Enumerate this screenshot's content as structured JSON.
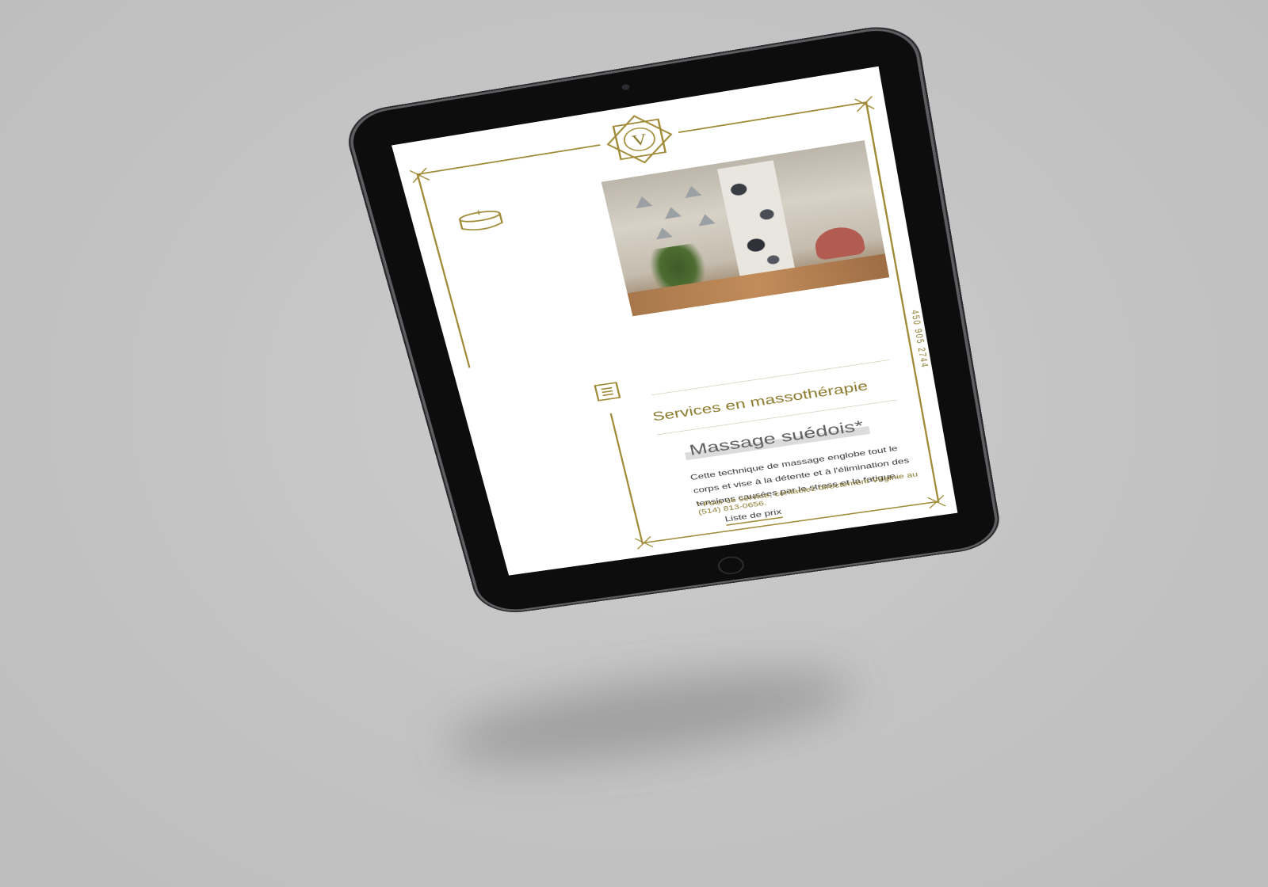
{
  "site": {
    "logo_letter": "V",
    "phone_vertical": "450 905 2744",
    "accent_color": "#8b7a2c"
  },
  "section": {
    "title": "Services en massothérapie"
  },
  "service": {
    "title": "Massage suédois*",
    "description": "Cette technique de massage englobe tout le corps et vise à la détente et à l'élimination des tensions causées par le stress et la fatigue.",
    "note": "* Pour ce service, contactez directement Virginie au (514) 813-0656.",
    "price_link": "Liste de prix"
  },
  "icons": {
    "candle": "candle-icon",
    "menu": "hamburger-menu-icon",
    "logo": "star-logo-icon"
  }
}
